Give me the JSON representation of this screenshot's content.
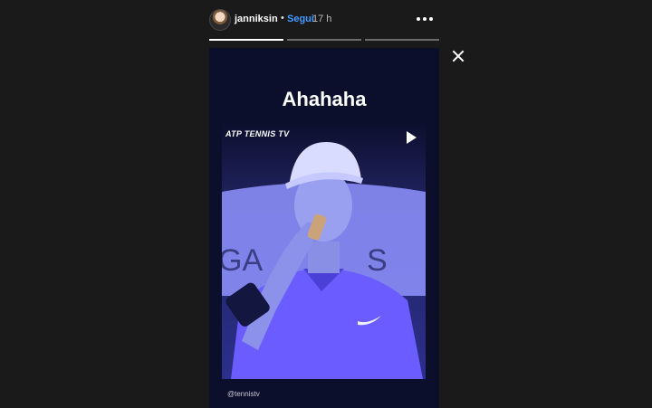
{
  "header": {
    "username": "janniksin",
    "separator": "•",
    "follow_label": "Segui",
    "time": "17 h",
    "more_icon": "more-horizontal-icon"
  },
  "progress": {
    "segments": 3,
    "current_segment": 1,
    "current_fill_fraction": 1.0
  },
  "story": {
    "caption": "Ahahaha",
    "video": {
      "brand": "ATP TENNIS TV",
      "play_icon": "play-icon"
    },
    "mention": "@tennistv"
  },
  "colors": {
    "background": "#1a1a1a",
    "follow": "#3d9bff",
    "story_bg": "#0b0f2b",
    "video_tint": "#3a3fc4"
  }
}
